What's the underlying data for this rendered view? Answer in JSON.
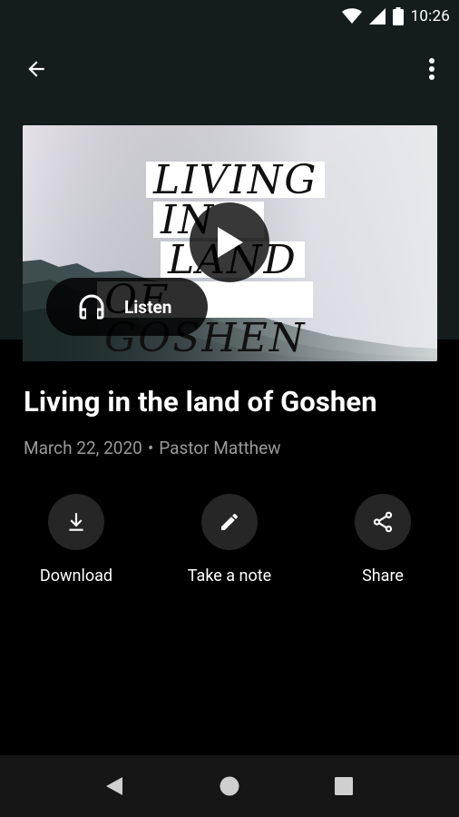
{
  "status_bar": {
    "time": "10:26"
  },
  "hero": {
    "artwork_lines": [
      "LIVING",
      "IN THE",
      "LAND",
      "OF GOSHEN"
    ],
    "listen_label": "Listen"
  },
  "sermon": {
    "title": "Living in the land of Goshen",
    "date": "March 22, 2020",
    "separator": "•",
    "speaker": "Pastor Matthew"
  },
  "actions": [
    {
      "label": "Download",
      "icon": "download-icon"
    },
    {
      "label": "Take a note",
      "icon": "pencil-icon"
    },
    {
      "label": "Share",
      "icon": "share-icon"
    }
  ],
  "colors": {
    "status_bar_bg": "#141c1e",
    "app_bar_bg": "#141c1e",
    "page_bg": "#000000",
    "meta_text": "#9a9a9a",
    "action_circle": "#262626",
    "nav_bar_bg": "#161616"
  }
}
